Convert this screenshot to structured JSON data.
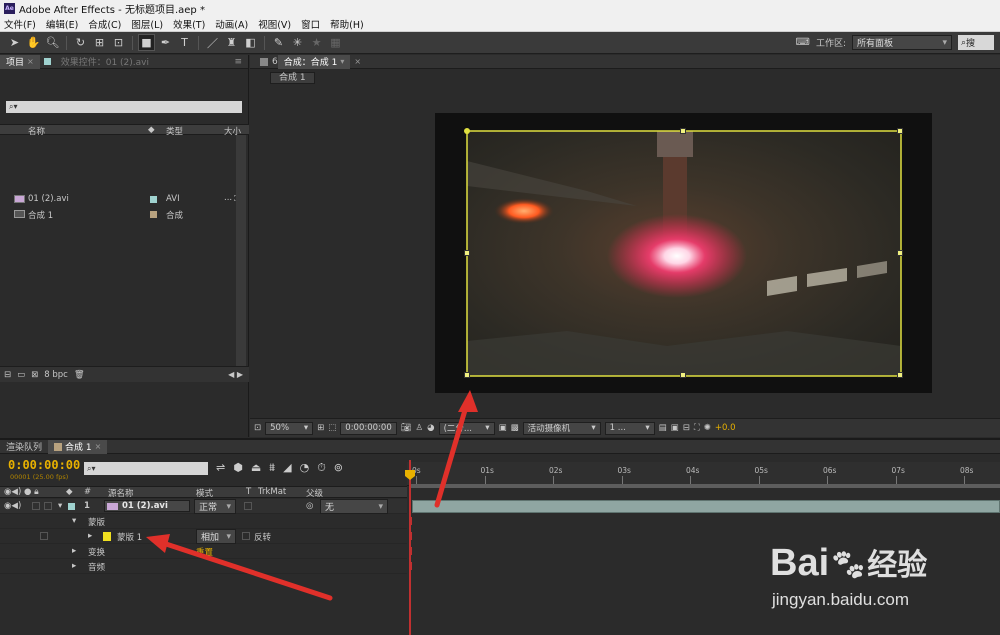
{
  "app": {
    "title": "Adobe After Effects - 无标题项目.aep *",
    "logo_text": "Ae"
  },
  "menu": [
    "文件(F)",
    "编辑(E)",
    "合成(C)",
    "图层(L)",
    "效果(T)",
    "动画(A)",
    "视图(V)",
    "窗口",
    "帮助(H)"
  ],
  "toolbar": {
    "workspace_label": "工作区:",
    "workspace_value": "所有面板",
    "search_placeholder": "搜"
  },
  "project_panel": {
    "tab_project": "项目",
    "tab_effects": "效果控件：01 (2).avi",
    "search_placeholder": "",
    "columns": {
      "name": "名称",
      "type": "类型",
      "size": "大小"
    },
    "items": [
      {
        "name": "01 (2).avi",
        "type": "AVI",
        "extra": "...",
        "color": "#9fd2cf"
      },
      {
        "name": "合成 1",
        "type": "合成",
        "extra": "",
        "color": "#b8a27f"
      }
    ],
    "bpc": "8 bpc"
  },
  "viewer": {
    "tab_label": "合成：合成 1",
    "breadcrumb": "合成 1",
    "zoom": "50%",
    "timecode": "0:00:00:00",
    "resolution": "(二分...",
    "camera": "活动摄像机",
    "views": "1 ...",
    "exposure": "+0.0"
  },
  "timeline": {
    "tab_render": "渲染队列",
    "tab_comp": "合成 1",
    "timecode": "0:00:00:00",
    "fps": "00001 (25.00 fps)",
    "search_placeholder": "",
    "headers": {
      "num": "#",
      "source": "源名称",
      "mode": "模式",
      "t": "T",
      "trkmat": "TrkMat",
      "parent": "父级"
    },
    "layer": {
      "num": "1",
      "name": "01 (2).avi",
      "mode": "正常",
      "parent": "无"
    },
    "masks_group": "蒙版",
    "mask": {
      "name": "蒙版 1",
      "mode": "相加",
      "inverted_label": "反转"
    },
    "transform": "变换",
    "audio": "音频",
    "reset": "重置",
    "ruler": [
      "0s",
      "01s",
      "02s",
      "03s",
      "04s",
      "05s",
      "06s",
      "07s",
      "08s"
    ]
  },
  "watermark": {
    "brand": "Bai",
    "brand2": "经验",
    "url": "jingyan.baidu.com"
  },
  "colors": {
    "accent_yellow": "#e8b100",
    "arrow": "#e0302a",
    "mask_yellow": "#e0e040"
  }
}
